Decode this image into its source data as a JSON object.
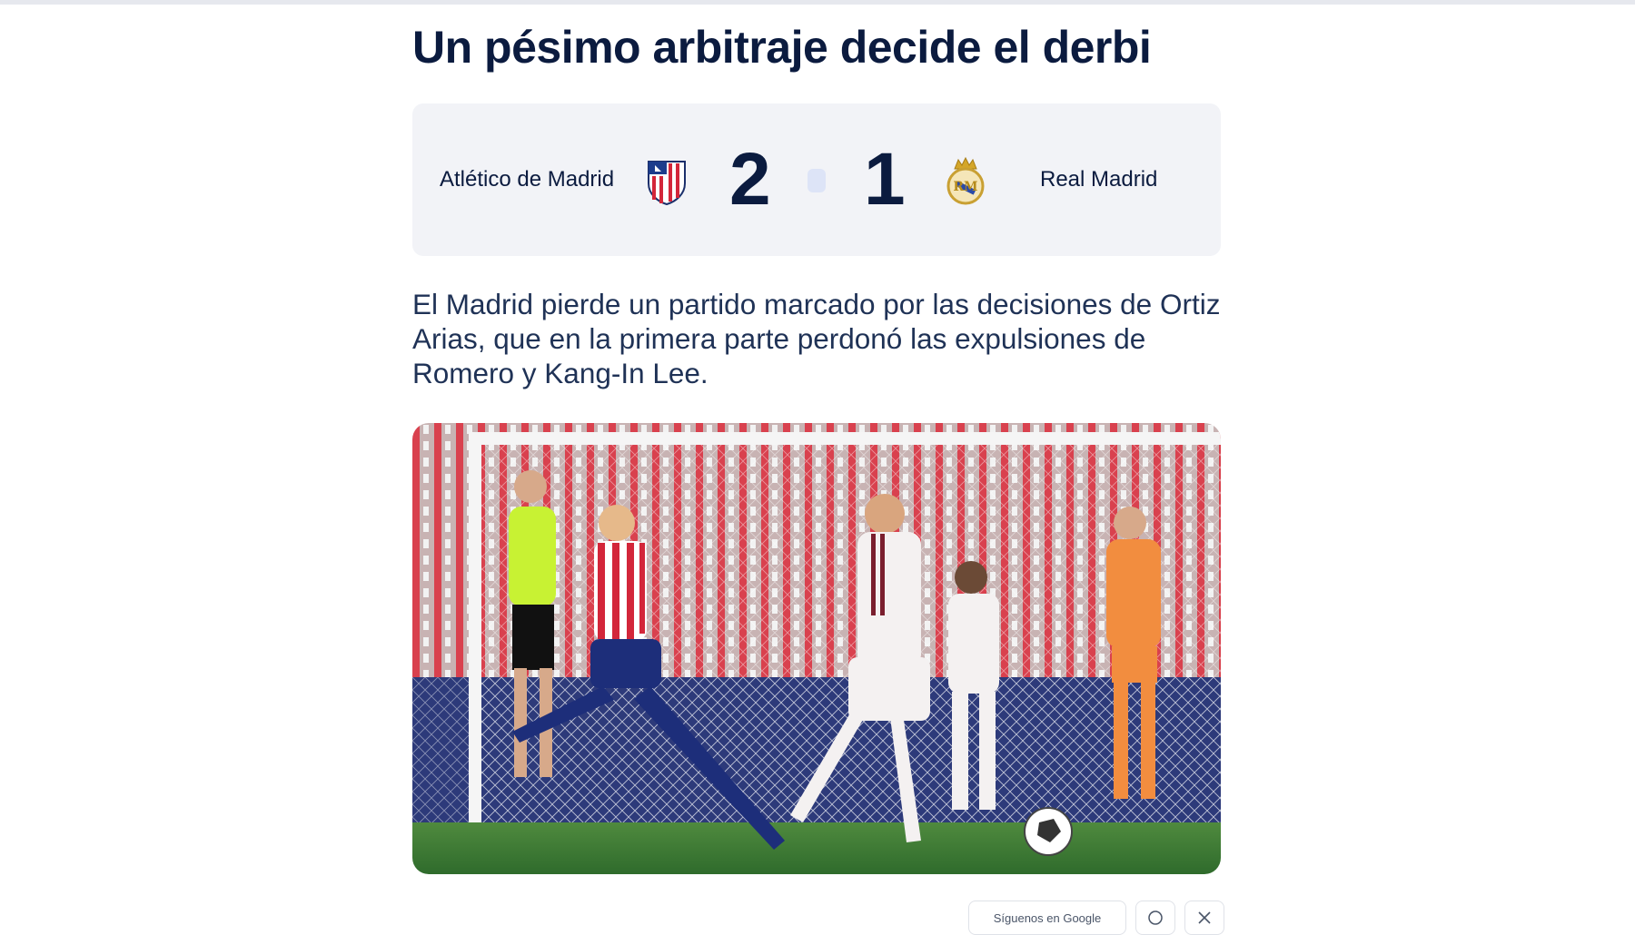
{
  "article": {
    "headline": "Un pésimo arbitraje decide el derbi",
    "standfirst": "El Madrid pierde un partido marcado por las decisiones de Ortiz Arias, que en la primera parte perdonó las expulsiones de Romero y Kang-In Lee."
  },
  "match": {
    "home_team": "Atlético de Madrid",
    "home_score": "2",
    "away_score": "1",
    "away_team": "Real Madrid",
    "home_crest": "atletico-madrid-crest-icon",
    "away_crest": "real-madrid-crest-icon"
  },
  "share": {
    "google_label": "Síguenos en Google",
    "whatsapp_icon": "whatsapp-icon",
    "x_icon": "x-icon"
  },
  "colors": {
    "text": "#0b1b3f",
    "scoreboard_bg": "#f2f3f7",
    "separator": "#dde4f7"
  }
}
